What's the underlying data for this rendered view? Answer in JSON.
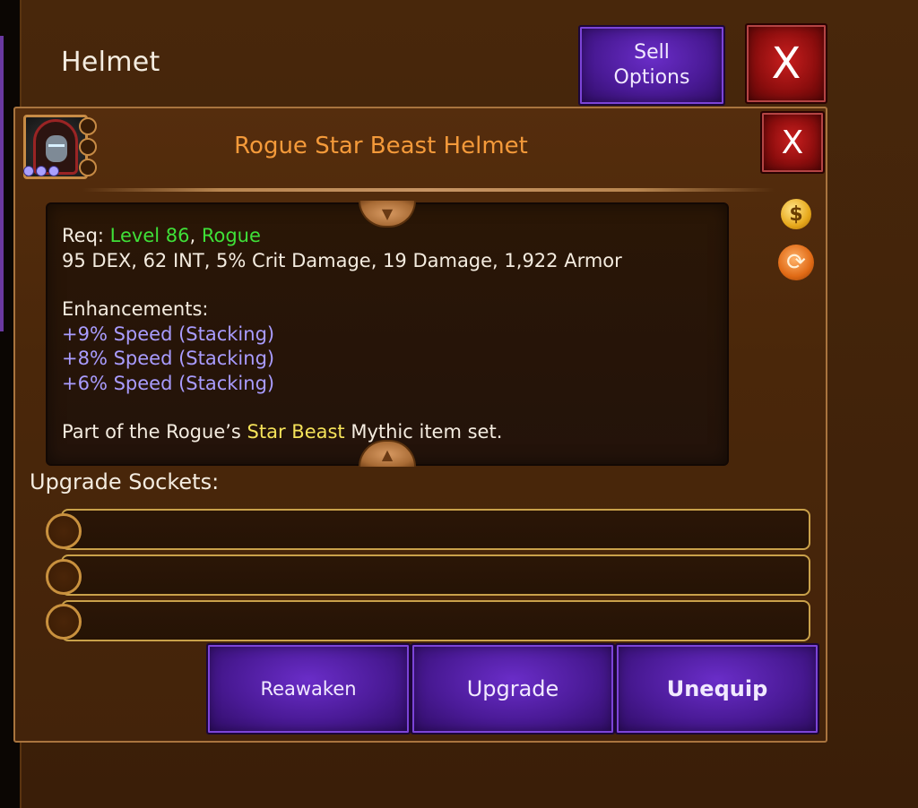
{
  "header": {
    "title": "Helmet",
    "sell_options_label": "Sell\nOptions",
    "close_label": "X"
  },
  "item": {
    "name": "Rogue Star Beast Helmet",
    "close_label": "X",
    "portrait_icon": "hooded-rogue-portrait",
    "description": {
      "req_prefix": "Req: ",
      "req_level": "Level 86",
      "req_separator": ", ",
      "req_class": "Rogue",
      "stats": "95 DEX, 62 INT, 5% Crit Damage, 19 Damage, 1,922 Armor",
      "enhancements_label": "Enhancements:",
      "enhancements": [
        "+9% Speed (Stacking)",
        "+8% Speed (Stacking)",
        "+6% Speed (Stacking)"
      ],
      "set_prefix": "Part of the Rogue’s ",
      "set_name": "Star Beast",
      "set_suffix": " Mythic item set."
    }
  },
  "sockets": {
    "label": "Upgrade Sockets:",
    "count": 3
  },
  "actions": {
    "reawaken": "Reawaken",
    "upgrade": "Upgrade",
    "unequip": "Unequip"
  },
  "colors": {
    "title_orange": "#f49a3a",
    "requirement_green": "#3fe038",
    "enhancement_blue": "#a99cff",
    "set_yellow": "#f5e35a",
    "button_purple": "#4a1a96",
    "close_red": "#8e0e0e"
  },
  "icons": {
    "side_top": "gold-bag-icon",
    "side_bottom": "swap-arrows-icon"
  }
}
